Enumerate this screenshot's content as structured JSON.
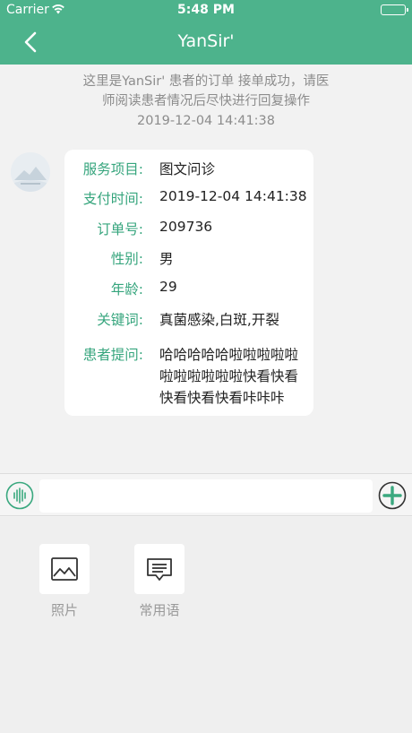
{
  "status_bar": {
    "carrier": "Carrier",
    "time": "5:48 PM"
  },
  "nav": {
    "title": "YanSir'"
  },
  "notice": {
    "line1": "这里是YanSir' 患者的订单 接单成功，请医",
    "line2": "师阅读患者情况后尽快进行回复操作",
    "time": "2019-12-04 14:41:38"
  },
  "order_card": {
    "rows": [
      {
        "label": "服务项目:",
        "value": "图文问诊"
      },
      {
        "label": "支付时间:",
        "value": "2019-12-04 14:41:38"
      },
      {
        "label": "订单号:",
        "value": "209736"
      },
      {
        "label": "性别:",
        "value": "男"
      },
      {
        "label": "年龄:",
        "value": "29"
      },
      {
        "label": "关键词:",
        "value": "真菌感染,白斑,开裂"
      },
      {
        "label": "患者提问:",
        "value": "哈哈哈哈哈啦啦啦啦啦啦啦啦啦啦啦快看快看快看快看快看咔咔咔"
      }
    ]
  },
  "input_bar": {
    "value": "",
    "placeholder": ""
  },
  "tools": [
    {
      "label": "照片",
      "icon": "image-icon"
    },
    {
      "label": "常用语",
      "icon": "message-icon"
    }
  ],
  "colors": {
    "brand": "#4db38c",
    "label_green": "#36a57d"
  }
}
